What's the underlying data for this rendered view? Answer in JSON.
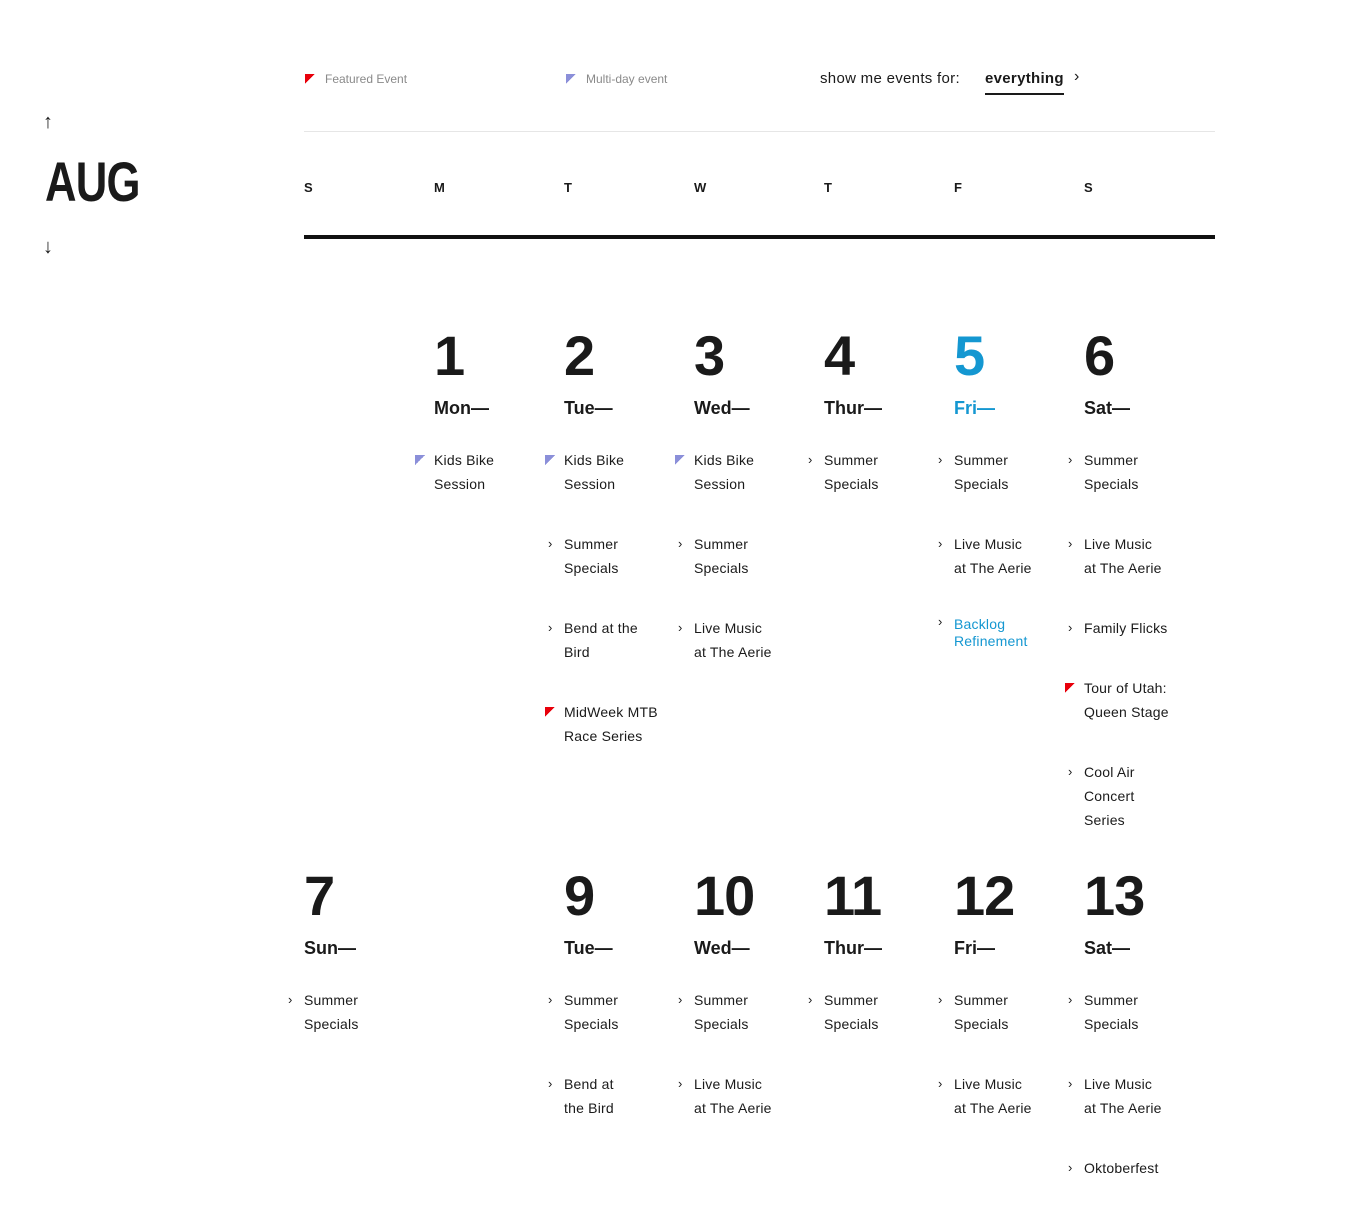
{
  "nav": {
    "up_icon": "arrow-up-icon",
    "down_icon": "arrow-down-icon",
    "month": "AUG"
  },
  "legend": {
    "featured": "Featured Event",
    "multiday": "Multi-day event",
    "colors": {
      "featured": "#e8000b",
      "multiday": "#8b8fd9",
      "today": "#1497d1"
    }
  },
  "filter": {
    "label": "show me events for:",
    "value": "everything",
    "icon": "chevron-right-icon"
  },
  "weekdays": [
    "S",
    "M",
    "T",
    "W",
    "T",
    "F",
    "S"
  ],
  "weeks": [
    {
      "days": [
        {
          "col": 1,
          "num": "1",
          "name": "Mon—",
          "events": [
            {
              "text": "Kids Bike Session",
              "lines": [
                "Kids Bike",
                "Session"
              ],
              "type": "multiday"
            }
          ]
        },
        {
          "col": 2,
          "num": "2",
          "name": "Tue—",
          "events": [
            {
              "lines": [
                "Kids Bike",
                "Session"
              ],
              "type": "multiday"
            },
            {
              "lines": [
                "Summer",
                "Specials"
              ],
              "type": "normal"
            },
            {
              "lines": [
                "Bend at the",
                "Bird"
              ],
              "type": "normal"
            },
            {
              "lines": [
                "MidWeek MTB",
                "Race Series"
              ],
              "type": "featured"
            }
          ]
        },
        {
          "col": 3,
          "num": "3",
          "name": "Wed—",
          "events": [
            {
              "lines": [
                "Kids Bike",
                "Session"
              ],
              "type": "multiday"
            },
            {
              "lines": [
                "Summer",
                "Specials"
              ],
              "type": "normal"
            },
            {
              "lines": [
                "Live Music",
                "at The Aerie"
              ],
              "type": "normal"
            }
          ]
        },
        {
          "col": 4,
          "num": "4",
          "name": "Thur—",
          "events": [
            {
              "lines": [
                "Summer",
                "Specials"
              ],
              "type": "normal"
            }
          ]
        },
        {
          "col": 5,
          "num": "5",
          "name": "Fri—",
          "today": true,
          "events": [
            {
              "lines": [
                "Summer",
                "Specials"
              ],
              "type": "normal"
            },
            {
              "lines": [
                "Live Music",
                "at The Aerie"
              ],
              "type": "normal"
            },
            {
              "lines": [
                "Backlog",
                "Refinement"
              ],
              "type": "link"
            }
          ]
        },
        {
          "col": 6,
          "num": "6",
          "name": "Sat—",
          "events": [
            {
              "lines": [
                "Summer",
                "Specials"
              ],
              "type": "normal"
            },
            {
              "lines": [
                "Live Music",
                "at The Aerie"
              ],
              "type": "normal"
            },
            {
              "lines": [
                "Family Flicks"
              ],
              "type": "normal"
            },
            {
              "lines": [
                "Tour of Utah:",
                "Queen Stage"
              ],
              "type": "featured"
            },
            {
              "lines": [
                "Cool Air",
                "Concert",
                "Series"
              ],
              "type": "normal"
            }
          ]
        }
      ]
    },
    {
      "days": [
        {
          "col": 0,
          "num": "7",
          "name": "Sun—",
          "events": [
            {
              "lines": [
                "Summer",
                "Specials"
              ],
              "type": "normal"
            }
          ]
        },
        {
          "col": 2,
          "num": "9",
          "name": "Tue—",
          "events": [
            {
              "lines": [
                "Summer",
                "Specials"
              ],
              "type": "normal"
            },
            {
              "lines": [
                "Bend at",
                "the Bird"
              ],
              "type": "normal"
            }
          ]
        },
        {
          "col": 3,
          "num": "10",
          "name": "Wed—",
          "events": [
            {
              "lines": [
                "Summer",
                "Specials"
              ],
              "type": "normal"
            },
            {
              "lines": [
                "Live Music",
                "at The Aerie"
              ],
              "type": "normal"
            }
          ]
        },
        {
          "col": 4,
          "num": "11",
          "name": "Thur—",
          "events": [
            {
              "lines": [
                "Summer",
                "Specials"
              ],
              "type": "normal"
            }
          ]
        },
        {
          "col": 5,
          "num": "12",
          "name": "Fri—",
          "events": [
            {
              "lines": [
                "Summer",
                "Specials"
              ],
              "type": "normal"
            },
            {
              "lines": [
                "Live Music",
                "at The Aerie"
              ],
              "type": "normal"
            }
          ]
        },
        {
          "col": 6,
          "num": "13",
          "name": "Sat—",
          "events": [
            {
              "lines": [
                "Summer",
                "Specials"
              ],
              "type": "normal"
            },
            {
              "lines": [
                "Live Music",
                "at The Aerie"
              ],
              "type": "normal"
            },
            {
              "lines": [
                "Oktoberfest"
              ],
              "type": "normal"
            }
          ]
        }
      ]
    }
  ]
}
